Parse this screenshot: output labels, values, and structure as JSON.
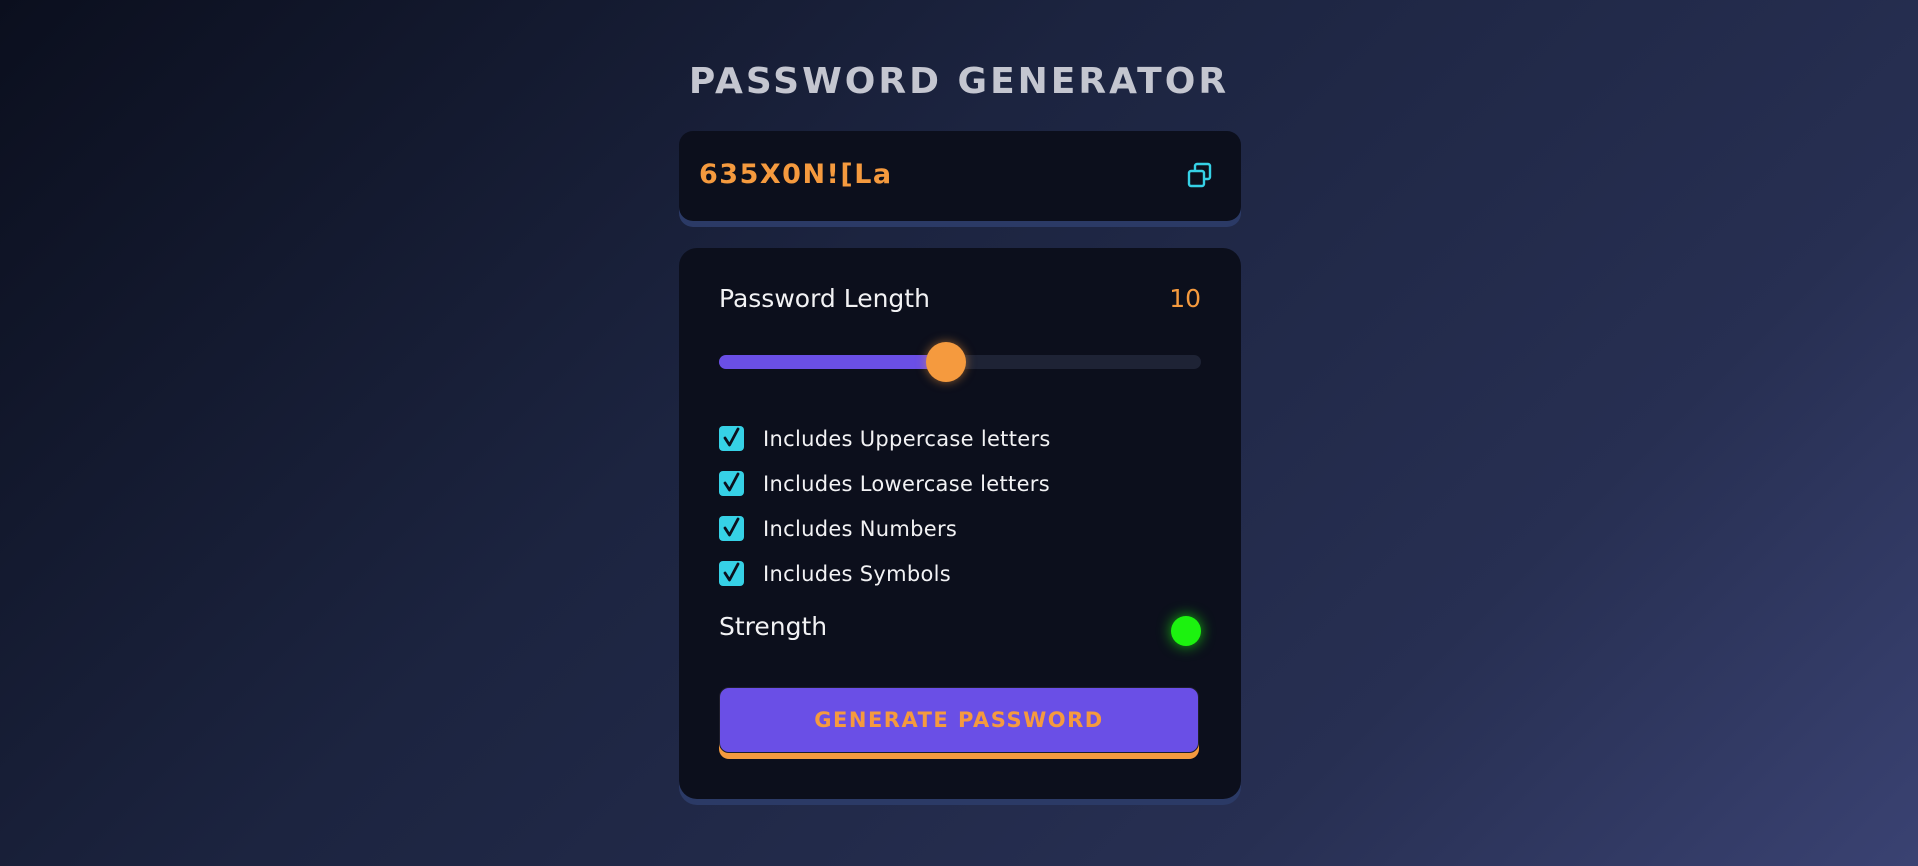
{
  "header": {
    "title": "PASSWORD GENERATOR"
  },
  "display": {
    "password": "635X0N![La",
    "copy_icon": "copy-icon"
  },
  "length": {
    "label": "Password Length",
    "value": "10",
    "slider_fraction": 0.47
  },
  "options": [
    {
      "label": "Includes Uppercase letters",
      "checked": true
    },
    {
      "label": "Includes Lowercase letters",
      "checked": true
    },
    {
      "label": "Includes Numbers",
      "checked": true
    },
    {
      "label": "Includes Symbols",
      "checked": true
    }
  ],
  "strength": {
    "label": "Strength",
    "indicator_color": "#1cf20f"
  },
  "actions": {
    "generate_label": "GENERATE PASSWORD"
  },
  "colors": {
    "accent": "#f59a3e",
    "primary": "#6a4fe6",
    "checkbox": "#36d1e6"
  }
}
